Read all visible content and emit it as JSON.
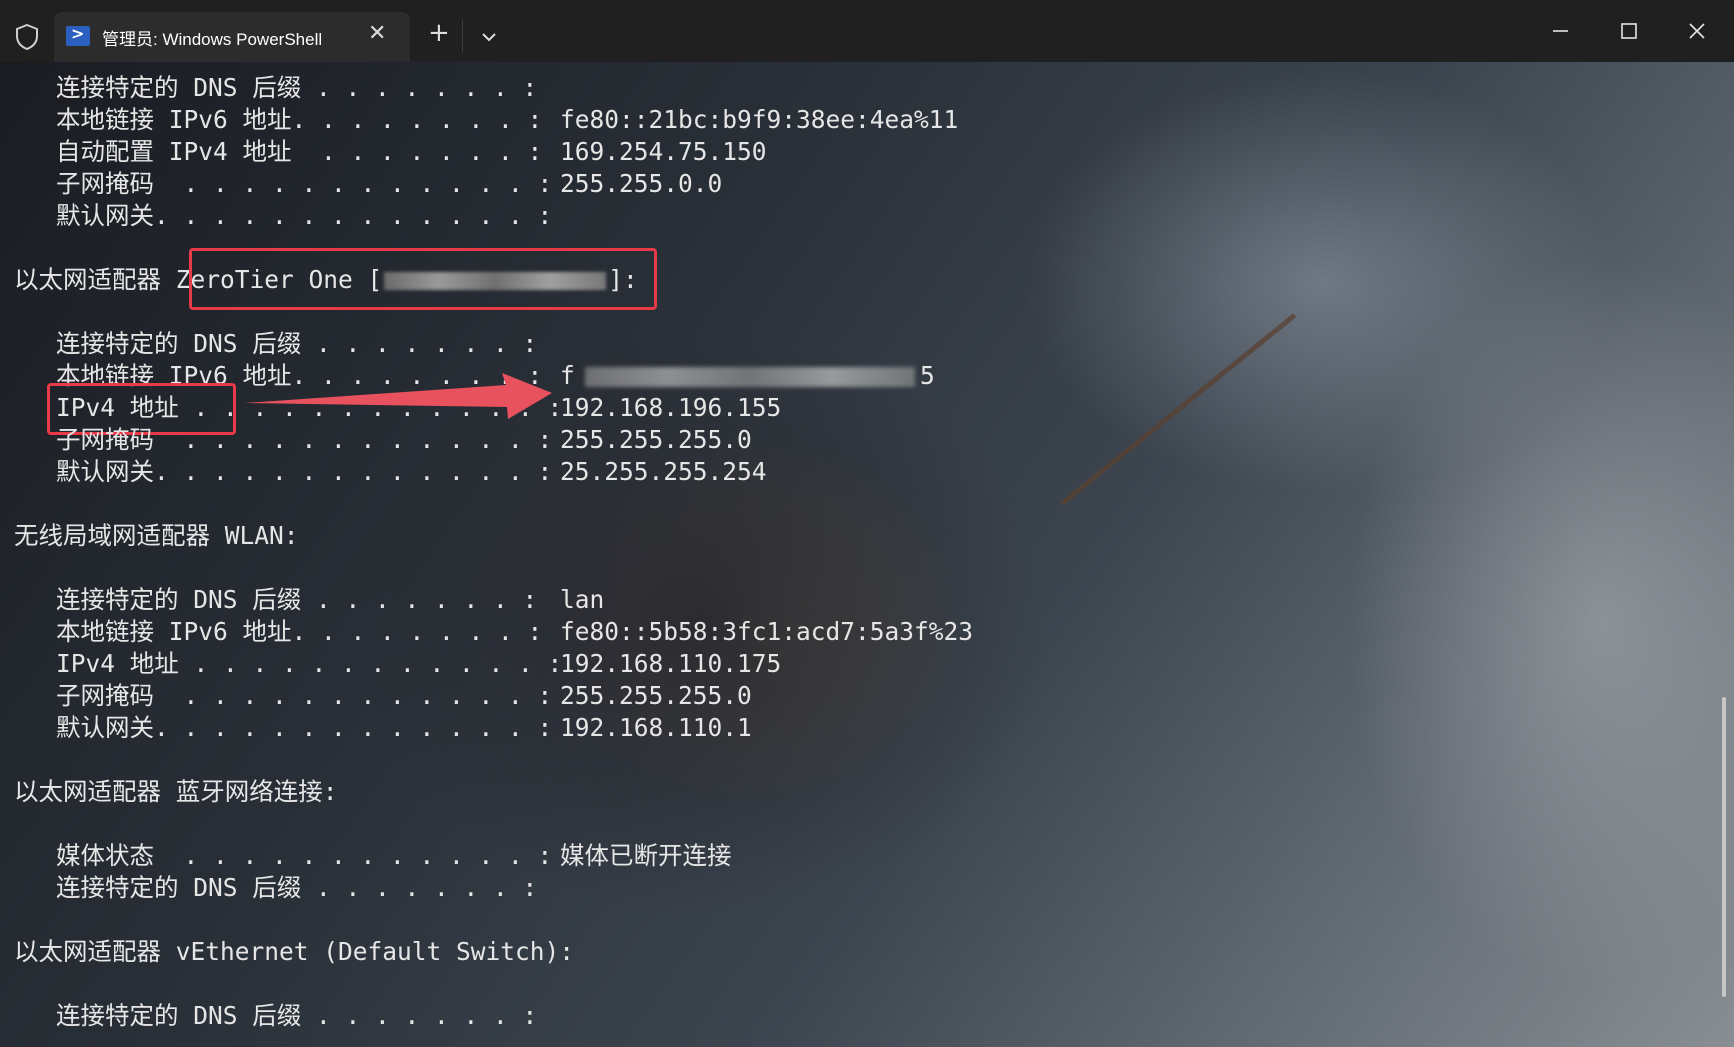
{
  "window": {
    "tab_title": "管理员: Windows PowerShell",
    "new_tab_label": "+",
    "tab_close_label": "✕"
  },
  "terminal": {
    "block1": {
      "dns_label": "连接特定的 DNS 后缀 . . . . . . . :",
      "ipv6_label": "本地链接 IPv6 地址. . . . . . . . :",
      "ipv6_value": "fe80::21bc:b9f9:38ee:4ea%11",
      "autoconf_label": "自动配置 IPv4 地址  . . . . . . . :",
      "autoconf_value": "169.254.75.150",
      "mask_label": "子网掩码  . . . . . . . . . . . . :",
      "mask_value": "255.255.0.0",
      "gateway_label": "默认网关. . . . . . . . . . . . . :"
    },
    "zerotier": {
      "header_prefix": "以太网适配器 ",
      "header_boxed_start": "ZeroTier One [",
      "header_boxed_end": "]:",
      "dns_label": "连接特定的 DNS 后缀 . . . . . . . :",
      "ipv6_label": "本地链接 IPv6 地址. . . . . . . . :",
      "ipv6_value_visible": "f",
      "ipv6_value_tail": "5",
      "ipv4_label": "IPv4 地址 . . . . . . . . . . . . :",
      "ipv4_value": "192.168.196.155",
      "mask_label": "子网掩码  . . . . . . . . . . . . :",
      "mask_value": "255.255.255.0",
      "gateway_label": "默认网关. . . . . . . . . . . . . :",
      "gateway_value": "25.255.255.254"
    },
    "wlan": {
      "header": "无线局域网适配器 WLAN:",
      "dns_label": "连接特定的 DNS 后缀 . . . . . . . :",
      "dns_value": "lan",
      "ipv6_label": "本地链接 IPv6 地址. . . . . . . . :",
      "ipv6_value": "fe80::5b58:3fc1:acd7:5a3f%23",
      "ipv4_label": "IPv4 地址 . . . . . . . . . . . . :",
      "ipv4_value": "192.168.110.175",
      "mask_label": "子网掩码  . . . . . . . . . . . . :",
      "mask_value": "255.255.255.0",
      "gateway_label": "默认网关. . . . . . . . . . . . . :",
      "gateway_value": "192.168.110.1"
    },
    "bluetooth": {
      "header": "以太网适配器 蓝牙网络连接:",
      "media_label": "媒体状态  . . . . . . . . . . . . :",
      "media_value": "媒体已断开连接",
      "dns_label": "连接特定的 DNS 后缀 . . . . . . . :"
    },
    "vethernet": {
      "header": "以太网适配器 vEthernet (Default Switch):",
      "dns_label": "连接特定的 DNS 后缀 . . . . . . . :"
    }
  },
  "colors": {
    "titlebar": "#202020",
    "tab": "#2c2c2c",
    "highlight_red": "#e83a48",
    "text": "#e6e6e6"
  },
  "icons": [
    "shield-icon",
    "powershell-icon",
    "close-icon",
    "plus-icon",
    "chevron-down-icon",
    "minimize-icon",
    "maximize-icon",
    "window-close-icon"
  ]
}
